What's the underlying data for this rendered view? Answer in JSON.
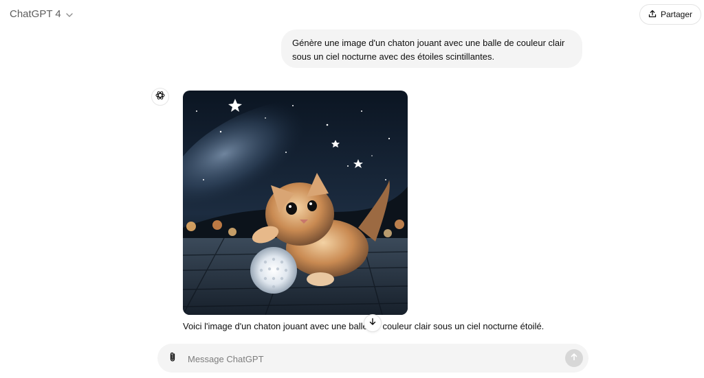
{
  "header": {
    "model_label": "ChatGPT 4",
    "share_label": "Partager"
  },
  "conversation": {
    "user_message": {
      "line1": "Génère une image d'un chaton jouant avec une balle de couleur clair",
      "line2": "sous un ciel nocturne avec des étoiles scintillantes."
    },
    "assistant_message": {
      "text": "Voici l'image d'un chaton jouant avec une balle de couleur clair sous un ciel nocturne étoilé."
    }
  },
  "composer": {
    "placeholder": "Message ChatGPT"
  },
  "icons": {
    "model_chevron": "chevron-down-icon",
    "share": "upload-icon",
    "assistant": "openai-logo-icon",
    "scroll": "arrow-down-icon",
    "attach": "paperclip-icon",
    "send": "arrow-up-icon"
  },
  "colors": {
    "bubble_bg": "#f4f4f4",
    "composer_bg": "#f4f4f4",
    "send_disabled": "#d7d7d7",
    "muted_text": "#5d5d5d"
  }
}
